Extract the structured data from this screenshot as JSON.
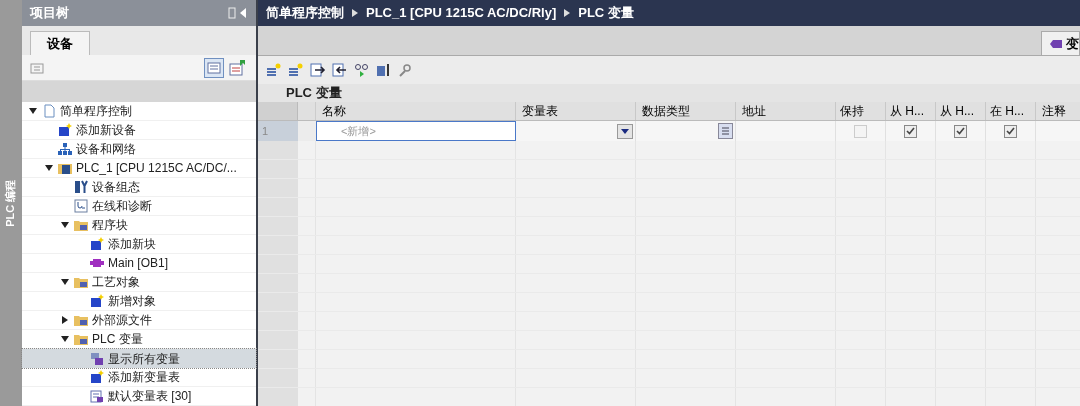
{
  "side_strip": {
    "label": "PLC 编程"
  },
  "project_tree": {
    "title": "项目树",
    "tabs": [
      {
        "label": "设备",
        "selected": true
      }
    ],
    "items": [
      {
        "label": "简单程序控制",
        "kind": "project",
        "expanded": true,
        "selected": false,
        "children": [
          {
            "label": "添加新设备",
            "kind": "add",
            "selected": false
          },
          {
            "label": "设备和网络",
            "kind": "network",
            "selected": false
          },
          {
            "label": "PLC_1 [CPU 1215C AC/DC/...",
            "kind": "device",
            "expanded": true,
            "selected": false,
            "children": [
              {
                "label": "设备组态",
                "kind": "config",
                "selected": false
              },
              {
                "label": "在线和诊断",
                "kind": "diagnostics",
                "selected": false
              },
              {
                "label": "程序块",
                "kind": "folder",
                "expanded": true,
                "selected": false,
                "children": [
                  {
                    "label": "添加新块",
                    "kind": "add",
                    "selected": false
                  },
                  {
                    "label": "Main [OB1]",
                    "kind": "block",
                    "selected": false
                  }
                ]
              },
              {
                "label": "工艺对象",
                "kind": "folder",
                "expanded": true,
                "selected": false,
                "children": [
                  {
                    "label": "新增对象",
                    "kind": "add",
                    "selected": false
                  }
                ]
              },
              {
                "label": "外部源文件",
                "kind": "folder",
                "expanded": false,
                "selected": false
              },
              {
                "label": "PLC 变量",
                "kind": "folder",
                "expanded": true,
                "selected": false,
                "children": [
                  {
                    "label": "显示所有变量",
                    "kind": "tags",
                    "selected": true
                  },
                  {
                    "label": "添加新变量表",
                    "kind": "add",
                    "selected": false
                  },
                  {
                    "label": "默认变量表 [30]",
                    "kind": "table",
                    "selected": false
                  }
                ]
              }
            ]
          }
        ]
      }
    ]
  },
  "editor": {
    "breadcrumb": [
      "简单程序控制",
      "PLC_1 [CPU 1215C AC/DC/Rly]",
      "PLC 变量"
    ],
    "side_tab": {
      "label": "变"
    },
    "title": "PLC 变量",
    "table": {
      "columns": [
        {
          "label": "名称",
          "kind": "text"
        },
        {
          "label": "变量表",
          "kind": "text"
        },
        {
          "label": "数据类型",
          "kind": "text"
        },
        {
          "label": "地址",
          "kind": "text"
        },
        {
          "label": "保持",
          "kind": "check"
        },
        {
          "label": "从 H...",
          "kind": "check"
        },
        {
          "label": "从 H...",
          "kind": "check"
        },
        {
          "label": "在 H...",
          "kind": "check"
        },
        {
          "label": "注释",
          "kind": "text"
        }
      ],
      "rows": [
        {
          "number": "1",
          "name_placeholder": "<新增>",
          "retain": {
            "checked": false,
            "disabled": true
          },
          "flags": [
            {
              "checked": true
            },
            {
              "checked": true
            },
            {
              "checked": true
            }
          ]
        }
      ]
    }
  }
}
